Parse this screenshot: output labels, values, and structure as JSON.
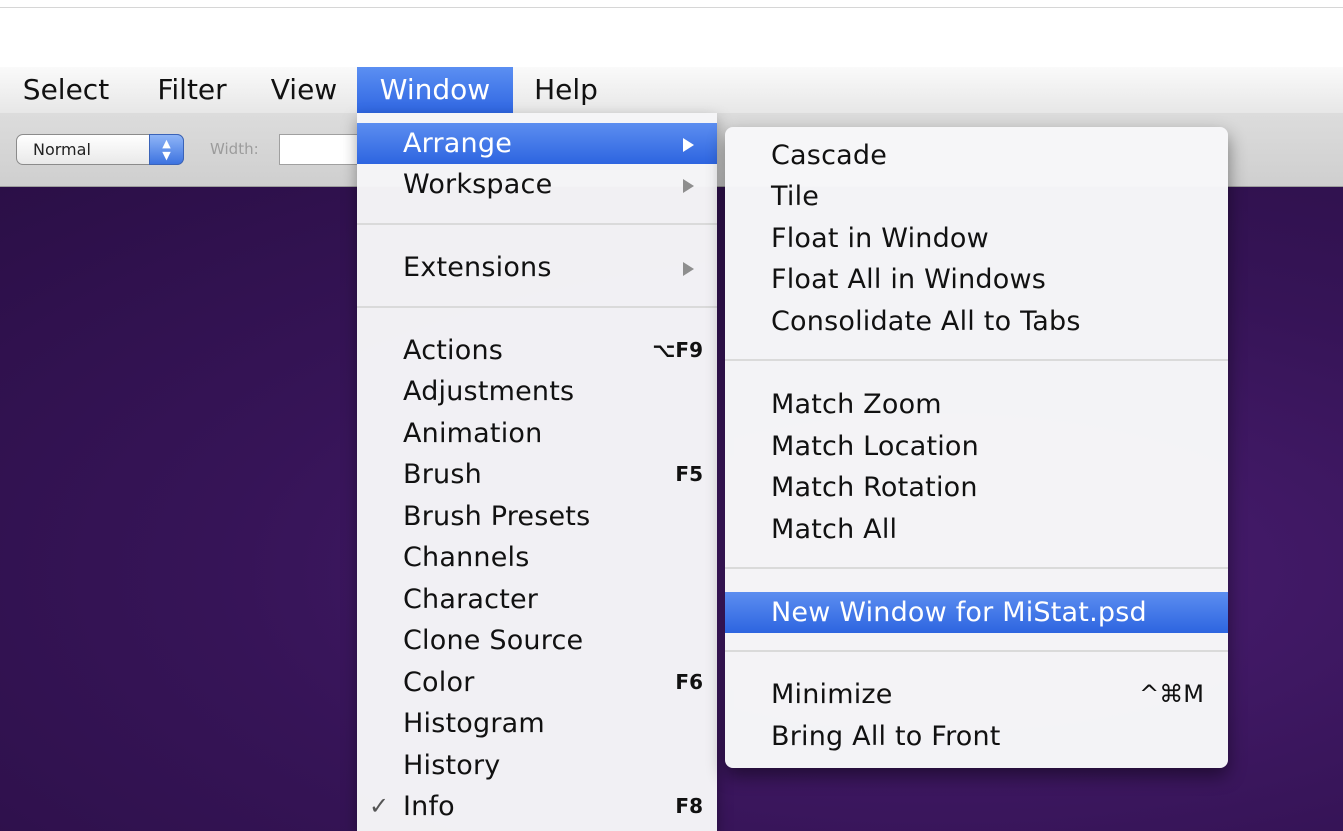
{
  "menubar": {
    "items": [
      "Select",
      "Filter",
      "View",
      "Window",
      "Help"
    ],
    "active": "Window"
  },
  "options": {
    "mode_value": "Normal",
    "width_label": "Width:",
    "width_value": ""
  },
  "window_menu": {
    "arrange": "Arrange",
    "workspace": "Workspace",
    "extensions": "Extensions",
    "actions": {
      "label": "Actions",
      "shortcut": "⌥F9"
    },
    "adjustments": "Adjustments",
    "animation": "Animation",
    "brush": {
      "label": "Brush",
      "shortcut": "F5"
    },
    "brush_presets": "Brush Presets",
    "channels": "Channels",
    "character": "Character",
    "clone_source": "Clone Source",
    "color": {
      "label": "Color",
      "shortcut": "F6"
    },
    "histogram": "Histogram",
    "history": "History",
    "info": {
      "label": "Info",
      "shortcut": "F8",
      "checked": true
    }
  },
  "arrange_submenu": {
    "cascade": "Cascade",
    "tile": "Tile",
    "float_in_window": "Float in Window",
    "float_all": "Float All in Windows",
    "consolidate": "Consolidate All to Tabs",
    "match_zoom": "Match Zoom",
    "match_location": "Match Location",
    "match_rotation": "Match Rotation",
    "match_all": "Match All",
    "new_window": "New Window for MiStat.psd",
    "minimize": {
      "label": "Minimize",
      "shortcut": "^⌘M"
    },
    "bring_all": "Bring All to Front"
  },
  "colors": {
    "highlight": "#3a70e6",
    "canvas": "#361457"
  },
  "icons": {
    "submenu_arrow": "triangle-right",
    "check": "✓",
    "stepper": "up-down-arrows"
  }
}
